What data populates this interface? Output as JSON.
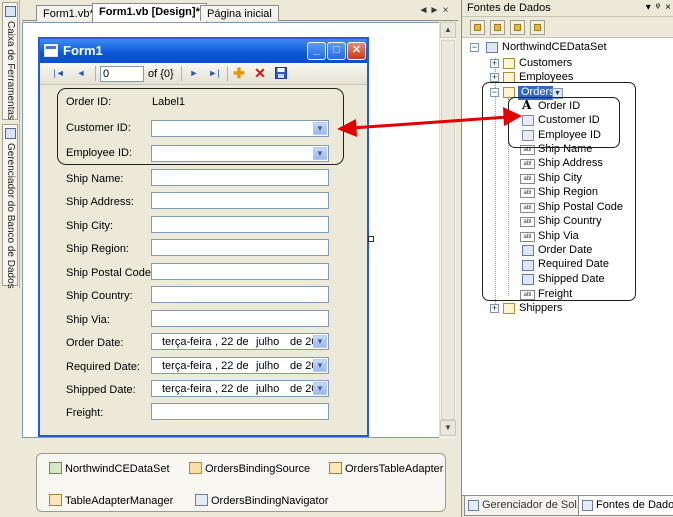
{
  "side_strip": {
    "toolbox_label": "Caixa de Ferramentas",
    "server_explorer_label": "Gerenciador do Banco de Dados"
  },
  "doc_tabs": [
    {
      "label": "Form1.vb*"
    },
    {
      "label": "Form1.vb [Design]*"
    },
    {
      "label": "Página inicial"
    }
  ],
  "doc_controls": {
    "left": "◄",
    "right": "►",
    "close": "×"
  },
  "form": {
    "title": "Form1",
    "navigator": {
      "position": "0",
      "count": "of {0}"
    },
    "fields": {
      "order_id": {
        "label": "Order ID:",
        "value": "Label1"
      },
      "customer_id": {
        "label": "Customer ID:"
      },
      "employee_id": {
        "label": "Employee ID:"
      },
      "ship_name": {
        "label": "Ship Name:"
      },
      "ship_address": {
        "label": "Ship Address:"
      },
      "ship_city": {
        "label": "Ship City:"
      },
      "ship_region": {
        "label": "Ship Region:"
      },
      "ship_postal_code": {
        "label": "Ship Postal Code:"
      },
      "ship_country": {
        "label": "Ship Country:"
      },
      "ship_via": {
        "label": "Ship Via:"
      },
      "order_date": {
        "label": "Order Date:"
      },
      "required_date": {
        "label": "Required Date:"
      },
      "shipped_date": {
        "label": "Shipped Date:"
      },
      "freight": {
        "label": "Freight:"
      }
    },
    "date_picker": {
      "weekday": "terça-feira",
      "day": ", 22 de",
      "month": "julho",
      "year": "de 20"
    }
  },
  "component_tray": [
    {
      "label": "NorthwindCEDataSet"
    },
    {
      "label": "OrdersBindingSource"
    },
    {
      "label": "OrdersTableAdapter"
    },
    {
      "label": "TableAdapterManager"
    },
    {
      "label": "OrdersBindingNavigator"
    }
  ],
  "data_sources": {
    "title": "Fontes de Dados",
    "controls": {
      "pin": "▾",
      "autohide": "ᵠ",
      "close": "×"
    },
    "tree": {
      "dataset": "NorthwindCEDataSet",
      "customers": "Customers",
      "employees": "Employees",
      "orders": "Orders",
      "order_fields": [
        {
          "name": "Order ID"
        },
        {
          "name": "Customer ID"
        },
        {
          "name": "Employee ID"
        },
        {
          "name": "Ship Name"
        },
        {
          "name": "Ship Address"
        },
        {
          "name": "Ship City"
        },
        {
          "name": "Ship Region"
        },
        {
          "name": "Ship Postal Code"
        },
        {
          "name": "Ship Country"
        },
        {
          "name": "Ship Via"
        },
        {
          "name": "Order Date"
        },
        {
          "name": "Required Date"
        },
        {
          "name": "Shipped Date"
        },
        {
          "name": "Freight"
        }
      ],
      "shippers": "Shippers"
    },
    "bottom_tabs": [
      {
        "label": "Gerenciador de Sol..."
      },
      {
        "label": "Fontes de Dados"
      }
    ],
    "abl": "abl"
  },
  "colors": {
    "accent": "#2a5ad7",
    "arrow": "#e00000",
    "selection": "#316ac5"
  }
}
